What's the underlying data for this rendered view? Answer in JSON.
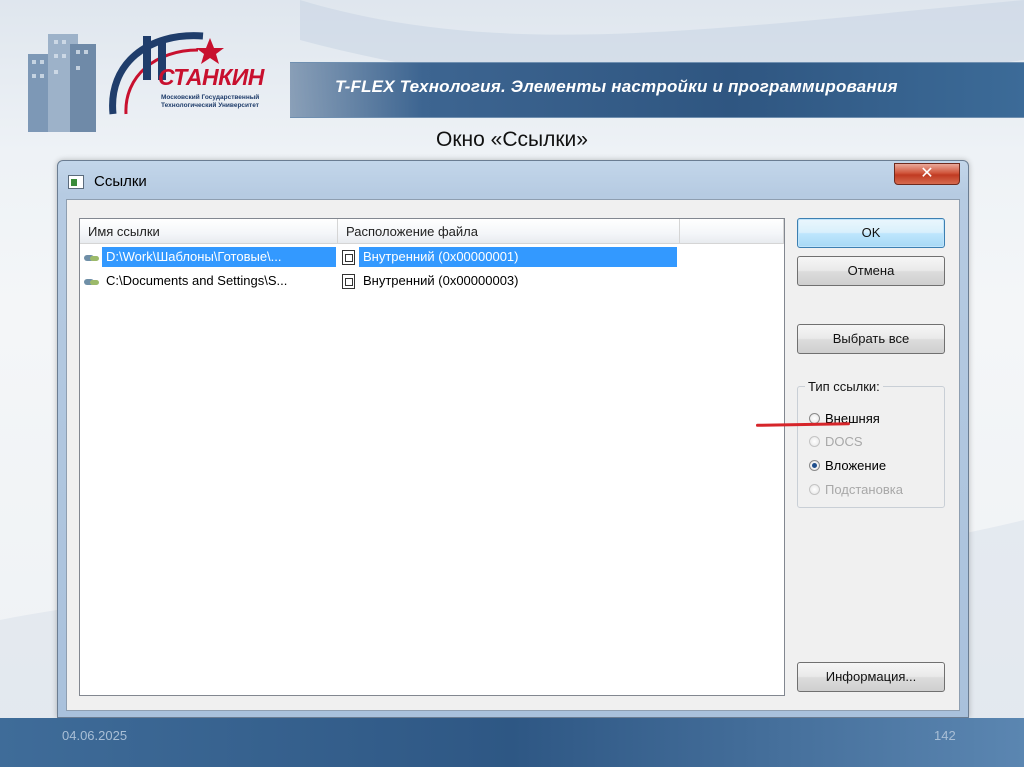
{
  "slide": {
    "header_title": "T-FLEX Технология. Элементы настройки и программирования",
    "heading": "Окно «Ссылки»",
    "footer_date": "04.06.2025",
    "footer_page": "142",
    "logo": {
      "name": "СТАНКИН",
      "subtitle": "Московский Государственный Технологический Университет"
    }
  },
  "dialog": {
    "title": "Ссылки",
    "close_symbol": "✕",
    "columns": [
      "Имя ссылки",
      "Расположение файла"
    ],
    "rows": [
      {
        "name": "D:\\Work\\Шаблоны\\Готовые\\...",
        "location": "Внутренний (0x00000001)",
        "selected": true
      },
      {
        "name": "C:\\Documents and Settings\\S...",
        "location": "Внутренний (0x00000003)",
        "selected": false
      }
    ],
    "buttons": {
      "ok": "OK",
      "cancel": "Отмена",
      "select_all": "Выбрать все",
      "info": "Информация..."
    },
    "link_type": {
      "label": "Тип ссылки:",
      "options": [
        {
          "label": "Внешняя",
          "checked": false,
          "enabled": true
        },
        {
          "label": "DOCS",
          "checked": false,
          "enabled": false
        },
        {
          "label": "Вложение",
          "checked": true,
          "enabled": true
        },
        {
          "label": "Подстановка",
          "checked": false,
          "enabled": false
        }
      ]
    },
    "colors": {
      "selection": "#3399ff",
      "annotation_underline": "#d6252a"
    }
  }
}
